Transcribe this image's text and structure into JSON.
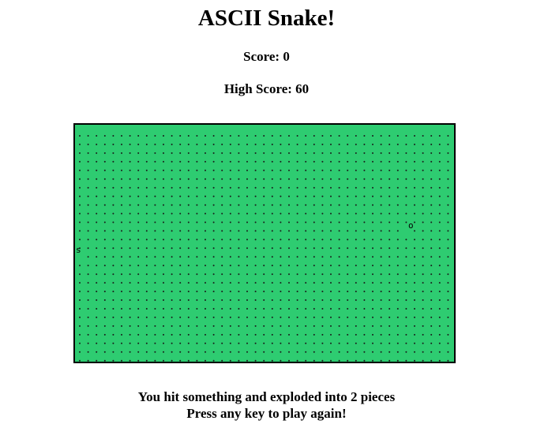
{
  "title": "ASCII Snake!",
  "score": {
    "label": "Score:",
    "value": 0,
    "text": "Score: 0"
  },
  "high_score": {
    "label": "High Score:",
    "value": 60,
    "text": "High Score: 60"
  },
  "board": {
    "background_color": "#2ecc71",
    "empty_char": ".",
    "snake_char": "s",
    "food_char": "o",
    "snake": {
      "symbol": "s"
    },
    "food": {
      "symbol": "o"
    }
  },
  "messages": {
    "line1": "You hit something and exploded into 2 pieces",
    "line2": "Press any key to play again!"
  }
}
